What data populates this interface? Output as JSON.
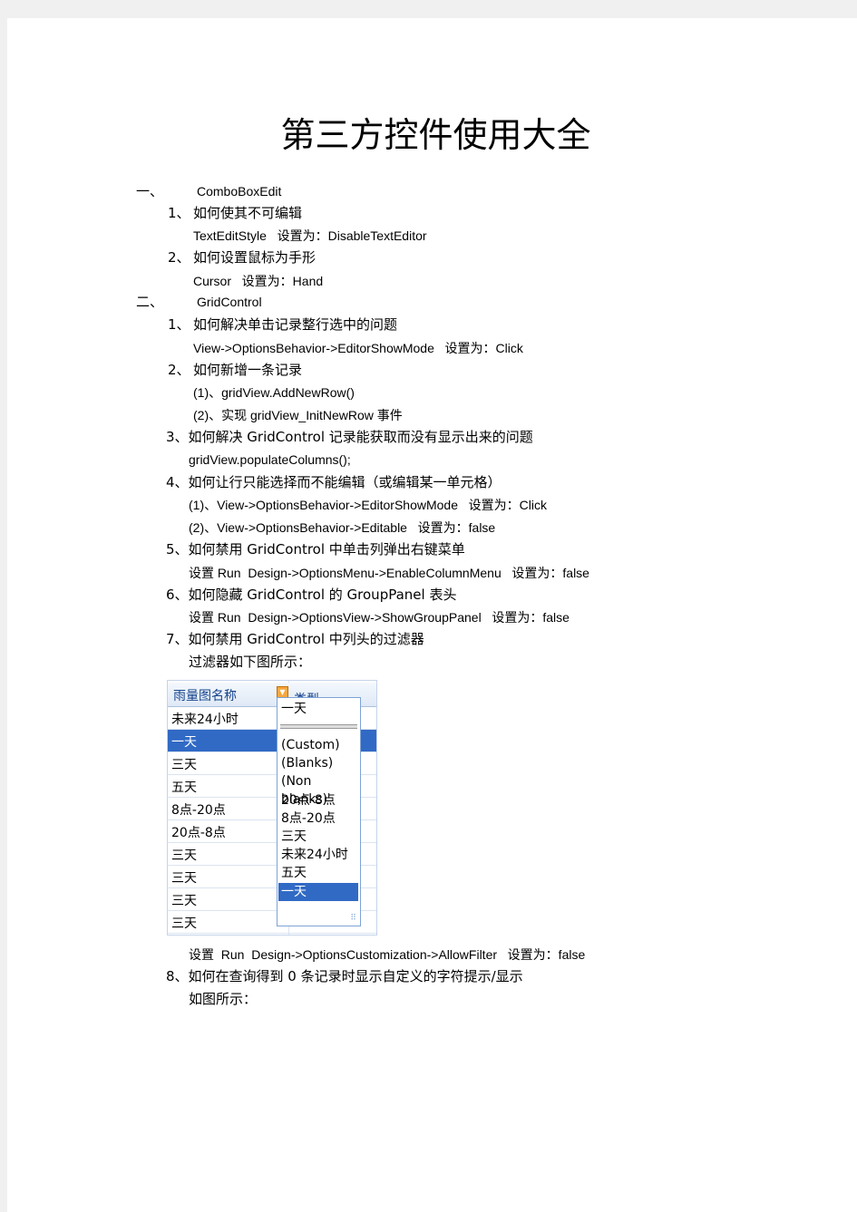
{
  "title": "第三方控件使用大全",
  "s1": {
    "num": "一、",
    "name": "ComboBoxEdit",
    "q1": {
      "num": "1、",
      "text": "如何使其不可编辑",
      "ans": "TextEditStyle   设置为：DisableTextEditor"
    },
    "q2": {
      "num": "2、",
      "text": "如何设置鼠标为手形",
      "ans": "Cursor   设置为：Hand"
    }
  },
  "s2": {
    "num": "二、",
    "name": "GridControl",
    "q1": {
      "num": "1、",
      "text": "如何解决单击记录整行选中的问题",
      "ans": "View->OptionsBehavior->EditorShowMode   设置为：Click"
    },
    "q2": {
      "num": "2、",
      "text": "如何新增一条记录",
      "a1": "(1)、gridView.AddNewRow()",
      "a2": "(2)、实现 gridView_InitNewRow 事件"
    },
    "q3": {
      "text": "3、如何解决 GridControl 记录能获取而没有显示出来的问题",
      "ans": "gridView.populateColumns();"
    },
    "q4": {
      "text": "4、如何让行只能选择而不能编辑（或编辑某一单元格）",
      "a1": "(1)、View->OptionsBehavior->EditorShowMode   设置为：Click",
      "a2": "(2)、View->OptionsBehavior->Editable   设置为：false"
    },
    "q5": {
      "text": "5、如何禁用 GridControl 中单击列弹出右键菜单",
      "ans": "设置 Run  Design->OptionsMenu->EnableColumnMenu   设置为：false"
    },
    "q6": {
      "text": "6、如何隐藏 GridControl 的 GroupPanel 表头",
      "ans": "设置 Run  Design->OptionsView->ShowGroupPanel   设置为：false"
    },
    "q7": {
      "text": "7、如何禁用 GridControl 中列头的过滤器",
      "ans1": "过滤器如下图所示：",
      "ans2": "设置  Run  Design->OptionsCustomization->AllowFilter   设置为：false"
    },
    "q8": {
      "text": "8、如何在查询得到 0 条记录时显示自定义的字符提示/显示",
      "ans": "如图所示："
    }
  },
  "grid": {
    "headers": [
      "雨量图名称",
      "类型"
    ],
    "rows": [
      "未来24小时",
      "一天",
      "三天",
      "五天",
      "8点-20点",
      "20点-8点",
      "三天",
      "三天",
      "三天",
      "三天"
    ],
    "selected_row": 1,
    "filter_dropdown": {
      "current": "一天",
      "items": [
        "(Custom)",
        "(Blanks)",
        "(Non blanks)",
        "20点-8点",
        "8点-20点",
        "三天",
        "未来24小时",
        "五天",
        "一天"
      ],
      "selected": "一天"
    }
  }
}
